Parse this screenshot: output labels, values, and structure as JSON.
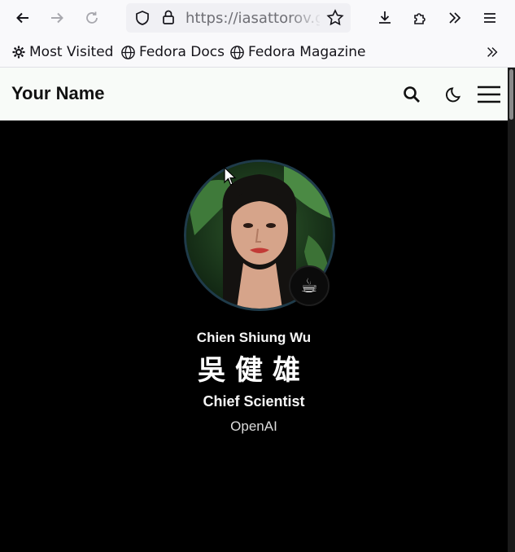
{
  "browser": {
    "url": "https://iasattorov.github.io",
    "bookmarks": [
      {
        "label": "Most Visited",
        "icon": "gear-icon"
      },
      {
        "label": "Fedora Docs",
        "icon": "globe-icon"
      },
      {
        "label": "Fedora Magazine",
        "icon": "globe-icon"
      }
    ]
  },
  "site": {
    "brand": "Your Name"
  },
  "profile": {
    "name": "Chien Shiung Wu",
    "name_cjk": "吳健雄",
    "role": "Chief Scientist",
    "organization": "OpenAI",
    "badge_emoji": "☕"
  },
  "colors": {
    "page_bg": "#000000",
    "header_bg": "#f8fbf8",
    "browser_bg": "#f9f9fb"
  }
}
